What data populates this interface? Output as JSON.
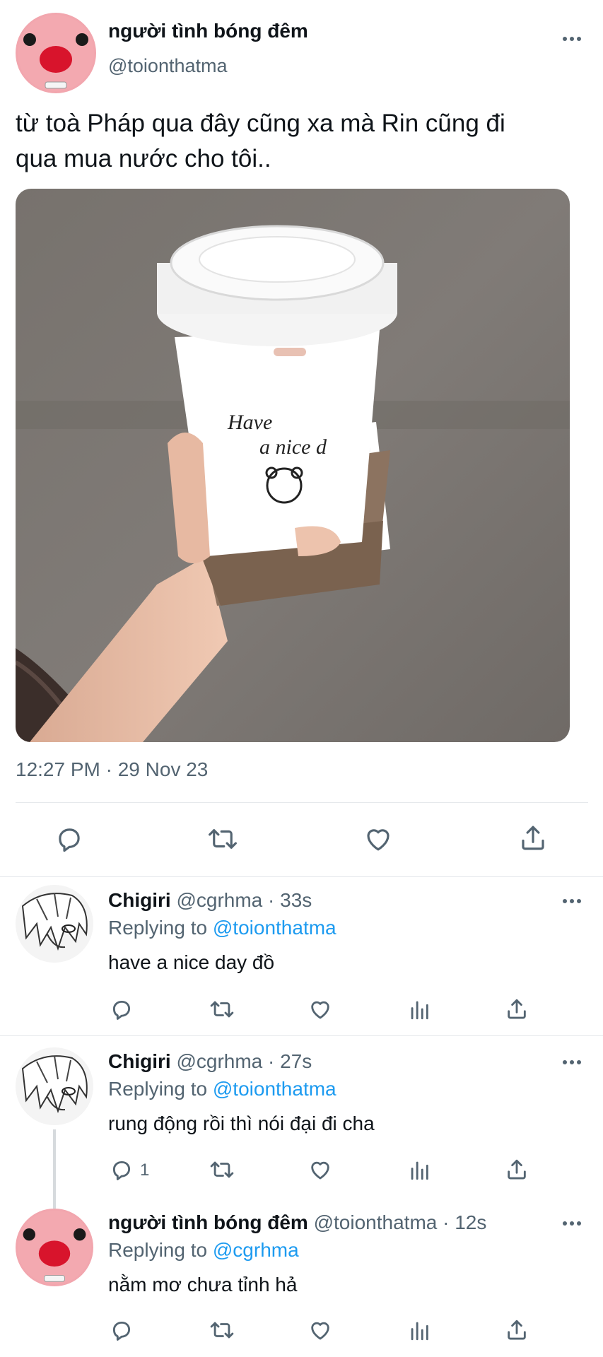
{
  "main_tweet": {
    "author_name": "người tình bóng đêm",
    "handle": "@toionthatma",
    "text_line1": "từ toà Pháp qua đây cũng xa mà Rin cũng đi",
    "text_line2": "qua mua nước cho tôi..",
    "cup_text_line1": "Have",
    "cup_text_line2": "a nice d",
    "timestamp": "12:27 PM · 29 Nov 23"
  },
  "replies": [
    {
      "author_name": "Chigiri",
      "handle_time": "@cgrhma · 33s",
      "replying_prefix": "Replying to",
      "replying_to": "@toionthatma",
      "text": "have a nice day đồ"
    },
    {
      "author_name": "Chigiri",
      "handle_time": "@cgrhma · 27s",
      "replying_prefix": "Replying to",
      "replying_to": "@toionthatma",
      "text": "rung động rồi thì nói đại đi cha",
      "reply_count": "1"
    },
    {
      "author_name": "người tình bóng đêm",
      "handle_time": "@toionthatma · 12s",
      "replying_prefix": "Replying to",
      "replying_to": "@cgrhma",
      "text": "nằm mơ chưa tỉnh hả"
    }
  ],
  "icons": [
    "reply-icon",
    "retweet-icon",
    "like-icon",
    "share-icon",
    "analytics-icon",
    "more-icon"
  ],
  "colors": {
    "link": "#1d9bf0",
    "muted": "#536471",
    "text": "#0f1419",
    "avatar_pink": "#f2a6ae"
  }
}
